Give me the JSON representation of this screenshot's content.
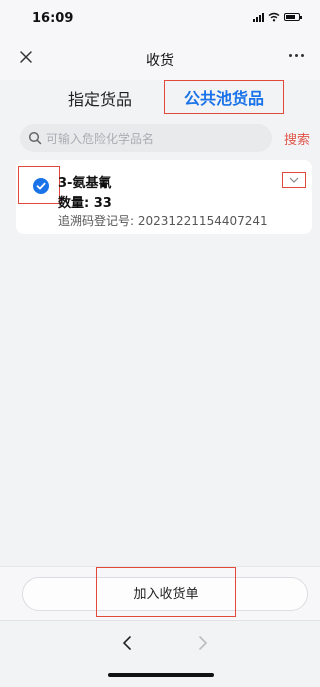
{
  "status_bar": {
    "time": "16:09"
  },
  "nav": {
    "title": "收货"
  },
  "tabs": [
    {
      "label": "指定货品",
      "active": false
    },
    {
      "label": "公共池货品",
      "active": true
    }
  ],
  "search": {
    "placeholder": "可输入危险化学品名",
    "button_label": "搜索"
  },
  "items": [
    {
      "checked": true,
      "name": "3-氨基氰",
      "quantity_label": "数量: 33",
      "trace_label": "追溯码登记号: 20231221154407241"
    }
  ],
  "footer": {
    "add_button_label": "加入收货单"
  },
  "colors": {
    "accent_blue": "#1a73e8",
    "search_red": "#e0574a",
    "highlight_red": "#e14a3b"
  },
  "icons": {
    "close": "close-icon",
    "more": "more-icon",
    "search": "search-icon",
    "check": "check-icon",
    "expand": "chevron-down-icon",
    "back": "chevron-left-icon",
    "forward": "chevron-right-icon"
  }
}
